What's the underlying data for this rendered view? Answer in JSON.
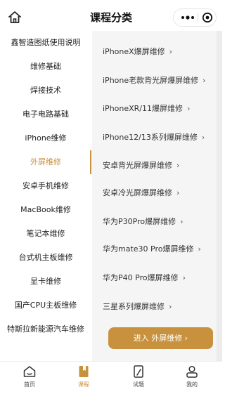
{
  "header": {
    "title": "课程分类",
    "home_icon": "home-icon",
    "more_icon": "more-dots-icon",
    "close_icon": "target-icon"
  },
  "sidebar": {
    "items": [
      {
        "label": "鑫智造图纸使用说明",
        "active": false
      },
      {
        "label": "维修基础",
        "active": false
      },
      {
        "label": "焊接技术",
        "active": false
      },
      {
        "label": "电子电路基础",
        "active": false
      },
      {
        "label": "iPhone维修",
        "active": false
      },
      {
        "label": "外屏维修",
        "active": true
      },
      {
        "label": "安卓手机维修",
        "active": false
      },
      {
        "label": "MacBook维修",
        "active": false
      },
      {
        "label": "笔记本维修",
        "active": false
      },
      {
        "label": "台式机主板维修",
        "active": false
      },
      {
        "label": "显卡维修",
        "active": false
      },
      {
        "label": "国产CPU主板维修",
        "active": false
      },
      {
        "label": "特斯拉新能源汽车维修",
        "active": false
      }
    ]
  },
  "content": {
    "items": [
      {
        "label": "iPhoneX爆屏维修"
      },
      {
        "label": "iPhone老款背光屏爆屏维修"
      },
      {
        "label": "iPhoneXR/11爆屏维修"
      },
      {
        "label": "iPhone12/13系列爆屏维修"
      },
      {
        "label": "安卓背光屏爆屏维修"
      },
      {
        "label": "安卓冷光屏爆屏维修"
      },
      {
        "label": "华为P30Pro爆屏维修"
      },
      {
        "label": "华为mate30 Pro爆屏维修"
      },
      {
        "label": "华为P40 Pro爆屏维修"
      },
      {
        "label": "三星系列爆屏维修"
      }
    ],
    "chevron": "›",
    "enter_button": "进入 外屏维修 ›"
  },
  "tabbar": {
    "tabs": [
      {
        "label": "首页",
        "icon": "home-tab-icon",
        "active": false
      },
      {
        "label": "课程",
        "icon": "course-book-icon",
        "active": true
      },
      {
        "label": "试题",
        "icon": "exam-paper-icon",
        "active": false
      },
      {
        "label": "我的",
        "icon": "user-icon",
        "active": false
      }
    ]
  },
  "colors": {
    "accent": "#c8913d",
    "panel_bg": "#f5f5f5",
    "text": "#333333"
  }
}
